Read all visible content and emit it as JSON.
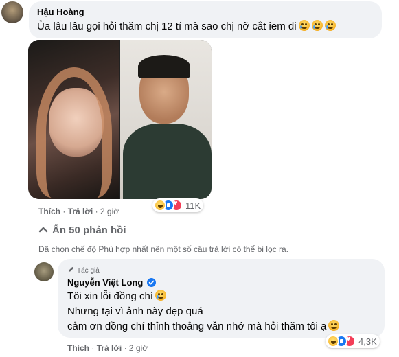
{
  "comment": {
    "author": "Hậu Hoàng",
    "text": "Ủa lâu lâu gọi hỏi thăm chị 12 tí mà sao chị nỡ cắt iem đi",
    "emoji": "sad-crying-emoji",
    "actions": {
      "like": "Thích",
      "reply": "Trả lời",
      "time": "2 giờ",
      "sep": "·"
    },
    "reaction_count": "11K",
    "reaction_icons": [
      "haha-icon",
      "like-icon",
      "love-icon"
    ]
  },
  "thread": {
    "toggle_label": "Ẩn 50 phản hồi",
    "filter_notice": "Đã chọn chế độ Phù hợp nhất nên một số câu trả lời có thể bị lọc ra."
  },
  "reply": {
    "badge": "Tác giả",
    "author": "Nguyễn Việt Long",
    "lines": [
      "Tôi xin lỗi đồng chí",
      "Nhưng tại vì ảnh này đẹp quá",
      "cảm ơn đồng chí thỉnh thoảng vẫn nhớ mà hỏi thăm tôi ạ"
    ],
    "actions": {
      "like": "Thích",
      "reply": "Trả lời",
      "time": "2 giờ",
      "sep": "·"
    },
    "reaction_count": "4,3K",
    "verified_color": "#1877f2"
  },
  "colors": {
    "bubble": "#f0f2f5",
    "meta": "#65676b",
    "accent": "#1877f2"
  }
}
